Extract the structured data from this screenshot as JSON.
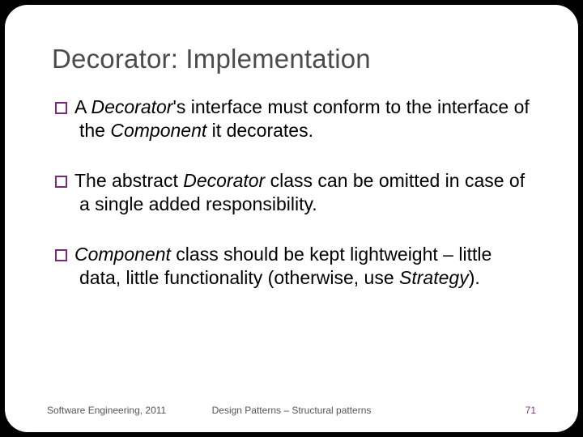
{
  "slide": {
    "title": "Decorator: Implementation",
    "bullets": [
      {
        "pre": "A ",
        "em1": "Decorator",
        "mid1": "'s interface must conform to the interface of the ",
        "em2": "Component",
        "post": " it decorates."
      },
      {
        "pre": "The abstract ",
        "em1": "Decorator",
        "mid1": " class can be omitted in case of a single added responsibility.",
        "em2": "",
        "post": ""
      },
      {
        "pre": "",
        "em1": "Component",
        "mid1": " class should be kept lightweight – little data, little functionality (otherwise, use ",
        "em2": "Strategy",
        "post": ")."
      }
    ]
  },
  "footer": {
    "left": "Software Engineering, 2011",
    "center": "Design Patterns – Structural patterns",
    "page": "71"
  }
}
